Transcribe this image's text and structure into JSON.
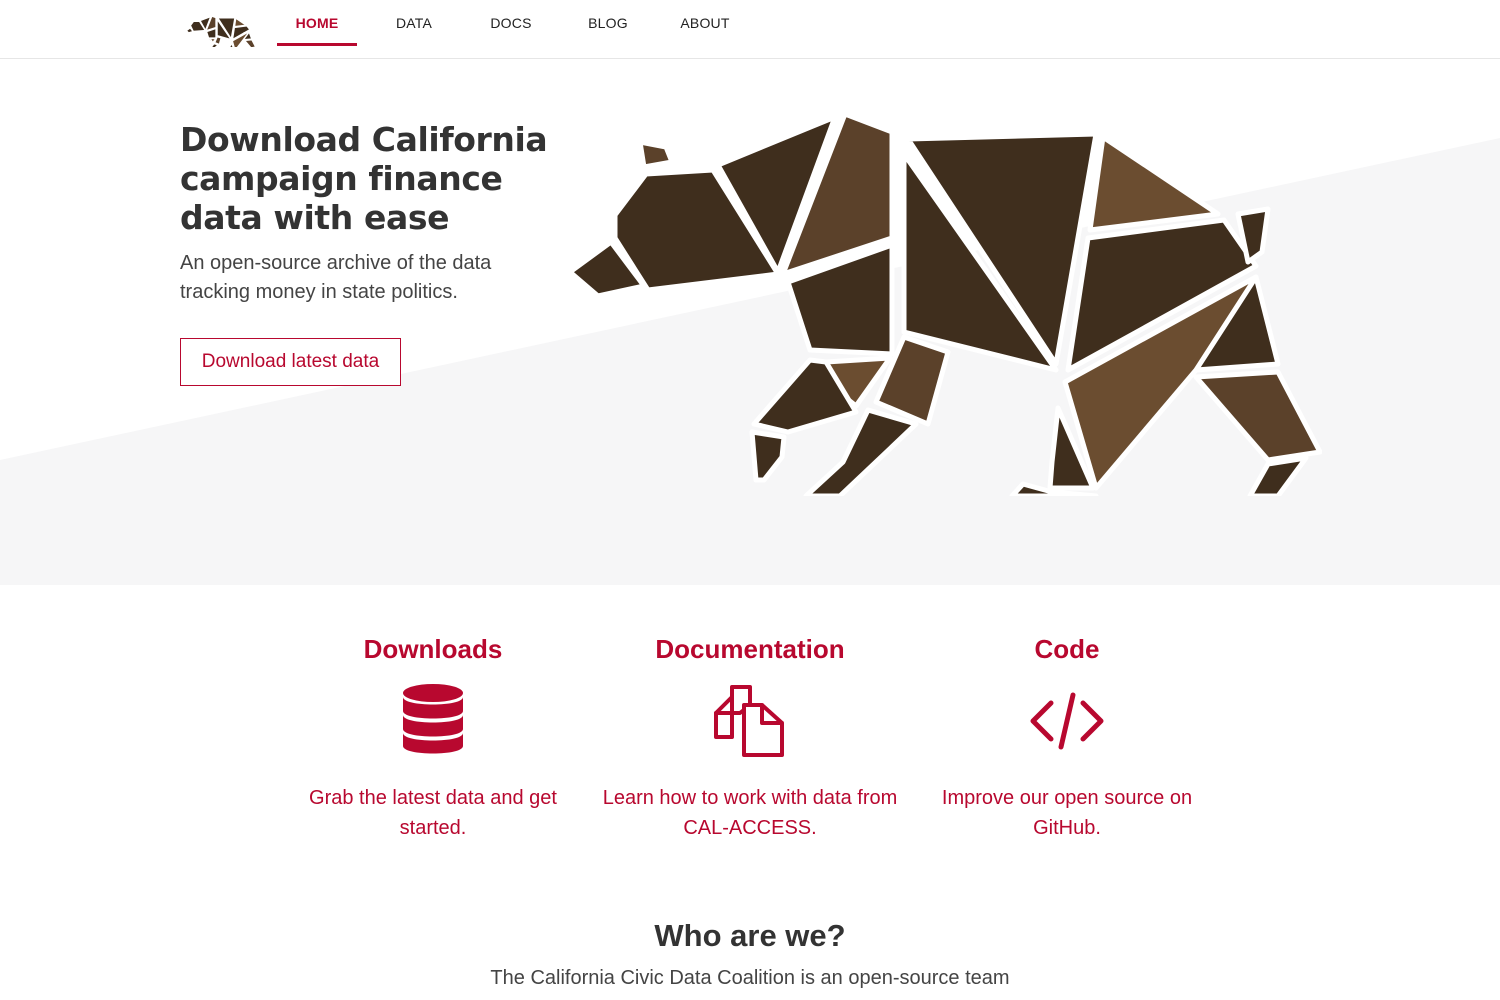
{
  "nav": {
    "items": [
      {
        "label": "HOME",
        "active": true
      },
      {
        "label": "DATA",
        "active": false
      },
      {
        "label": "DOCS",
        "active": false
      },
      {
        "label": "BLOG",
        "active": false
      },
      {
        "label": "ABOUT",
        "active": false
      }
    ]
  },
  "hero": {
    "title": "Download California campaign finance data with ease",
    "subtitle": "An open-source archive of the data tracking money in state politics.",
    "button_label": "Download latest data"
  },
  "features": [
    {
      "title": "Downloads",
      "description": "Grab the latest data and get started.",
      "icon": "database-icon"
    },
    {
      "title": "Documentation",
      "description": "Learn how to work with data from CAL-ACCESS.",
      "icon": "documents-icon"
    },
    {
      "title": "Code",
      "description": "Improve our open source on GitHub.",
      "icon": "code-icon"
    }
  ],
  "about": {
    "title": "Who are we?",
    "text": "The California Civic Data Coalition is an open-source team"
  },
  "colors": {
    "accent": "#b8082f",
    "bear_dark": "#3f2e1d",
    "bear_medium": "#5b412a",
    "bear_light": "#6b4d30",
    "hero_band": "#f6f6f7"
  }
}
